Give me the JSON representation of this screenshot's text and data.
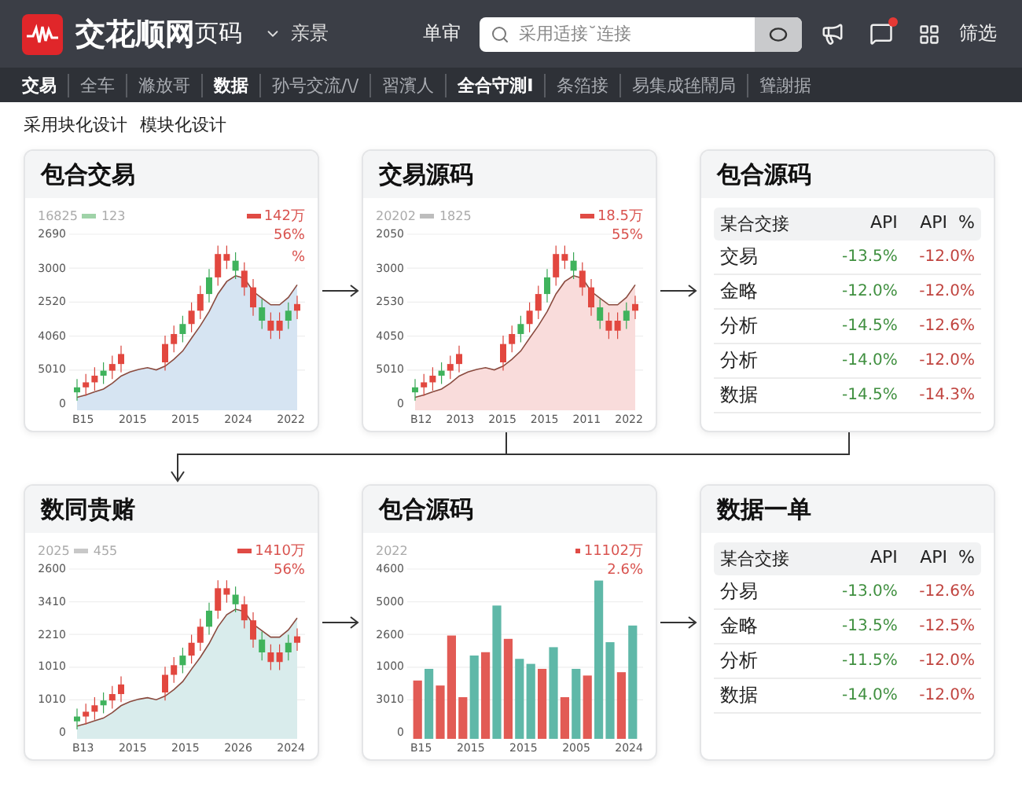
{
  "header": {
    "brand": "交花顺网",
    "brand_suffix": "页码",
    "menu": "亲景",
    "link": "单审",
    "search": {
      "placeholder": "采用适接˘连接"
    },
    "alert": true,
    "filter": "筛选"
  },
  "nav": [
    {
      "label": "交易",
      "bold": true
    },
    {
      "label": "全车",
      "bold": false
    },
    {
      "label": "滌放哥",
      "bold": false
    },
    {
      "label": "数据",
      "bold": true
    },
    {
      "label": "孙号交流/\\/",
      "bold": false
    },
    {
      "label": "習濱人",
      "bold": false
    },
    {
      "label": "全合守測I",
      "bold": true
    },
    {
      "label": "条箔接",
      "bold": false
    },
    {
      "label": "易集成毪鬧局",
      "bold": false
    },
    {
      "label": "聳謝据",
      "bold": false
    }
  ],
  "breadcrumbs": [
    "采用块化设计",
    "模块化设计"
  ],
  "rows": [
    [
      {
        "kind": "candles",
        "title": "包合交易",
        "color": "#d6e4f2",
        "legend": {
          "label": "16825",
          "series": "123",
          "color": "#9fd3a8",
          "total": "142万"
        },
        "notes": [
          "56%",
          "%"
        ],
        "y_labels": [
          "2690",
          "3000",
          "2520",
          "4060",
          "5010",
          "0"
        ],
        "x_labels": [
          "B15",
          "2015",
          "2015",
          "2024",
          "2022"
        ]
      },
      {
        "kind": "candles",
        "title": "交易源码",
        "color": "#f9dcdb",
        "legend": {
          "label": "20202",
          "series": "1825",
          "color": "#bdbdbd",
          "total": "18.5万"
        },
        "notes": [
          "55%"
        ],
        "y_labels": [
          "2050",
          "3000",
          "2530",
          "4050",
          "5010",
          "0"
        ],
        "x_labels": [
          "B12",
          "2013",
          "2015",
          "2015",
          "2011",
          "2022"
        ]
      },
      {
        "kind": "table",
        "title": "包合源码",
        "columns": [
          "某合交接",
          "API",
          "API  %"
        ],
        "rows": [
          {
            "name": "交易",
            "api": "-13.5%",
            "api_pct": "-12.0%"
          },
          {
            "name": "金略",
            "api": "-12.0%",
            "api_pct": "-12.0%"
          },
          {
            "name": "分析",
            "api": "-14.5%",
            "api_pct": "-12.6%"
          },
          {
            "name": "分析",
            "api": "-14.0%",
            "api_pct": "-12.0%"
          },
          {
            "name": "数据",
            "api": "-14.5%",
            "api_pct": "-14.3%"
          }
        ]
      }
    ],
    [
      {
        "kind": "candles",
        "title": "数同贵赌",
        "color": "#d9ecec",
        "legend": {
          "label": "2025",
          "series": "455",
          "color": "#c8c8c8",
          "total": "1410万"
        },
        "notes": [
          "56%"
        ],
        "y_labels": [
          "2600",
          "3410",
          "2210",
          "1010",
          "1010",
          "0"
        ],
        "x_labels": [
          "B13",
          "2015",
          "2015",
          "2026",
          "2024"
        ]
      },
      {
        "kind": "bars",
        "title": "包合源码",
        "legend": {
          "label": "2022",
          "total": "11102万"
        },
        "notes": [
          "2.6%"
        ],
        "y_labels": [
          "4600",
          "5000",
          "2600",
          "1000",
          "3010",
          "0"
        ],
        "x_labels": [
          "B15",
          "2015",
          "2015",
          "2005",
          "2024"
        ]
      },
      {
        "kind": "table",
        "title": "数据一单",
        "columns": [
          "某合交接",
          "API",
          "API  %"
        ],
        "rows": [
          {
            "name": "分易",
            "api": "-13.0%",
            "api_pct": "-12.6%"
          },
          {
            "name": "金略",
            "api": "-13.5%",
            "api_pct": "-12.5%"
          },
          {
            "name": "分析",
            "api": "-11.5%",
            "api_pct": "-12.0%"
          },
          {
            "name": "数据",
            "api": "-14.0%",
            "api_pct": "-12.0%"
          }
        ]
      }
    ]
  ]
}
